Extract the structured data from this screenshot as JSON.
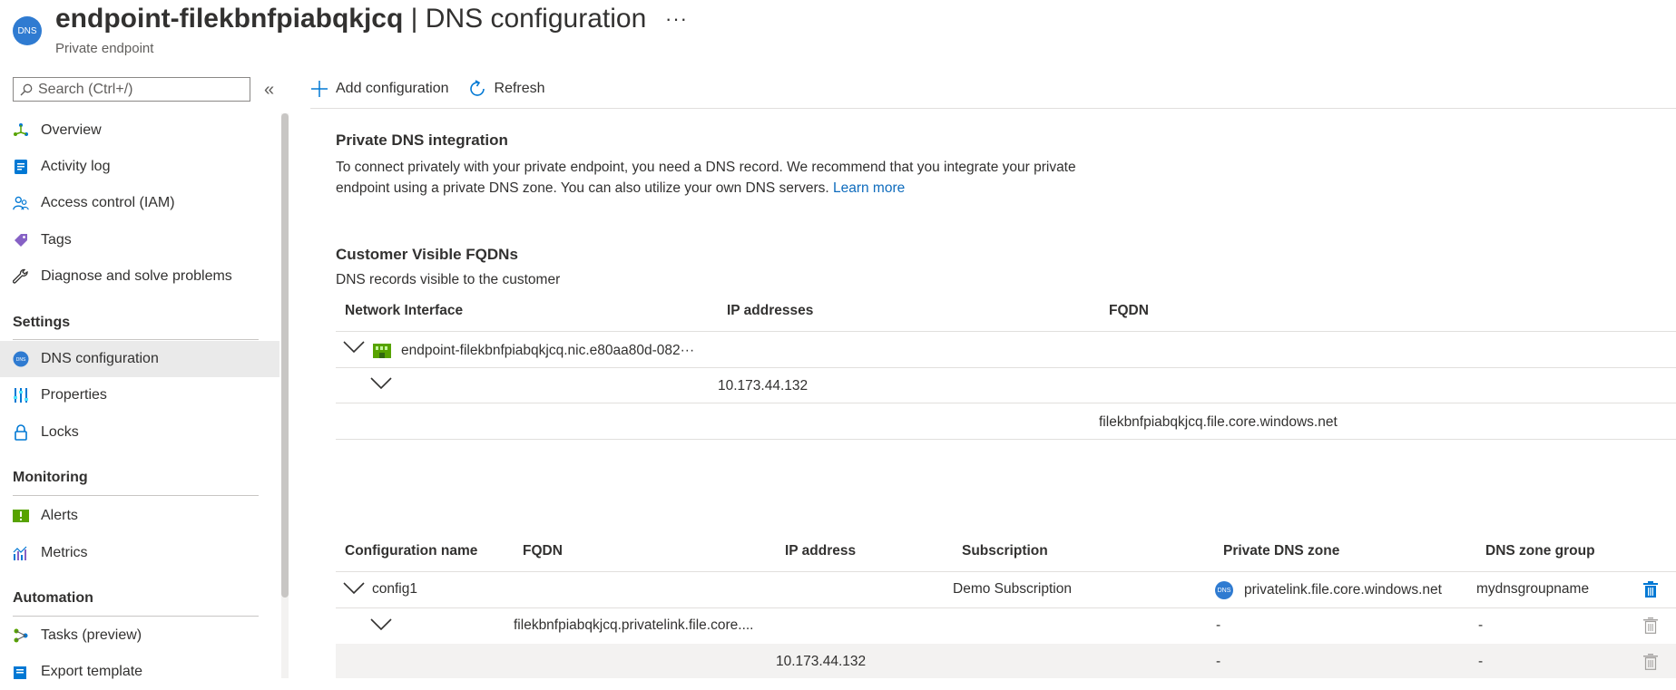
{
  "header": {
    "icon_text": "DNS",
    "resource_name": "endpoint-filekbnfpiabqkjcq",
    "separator": " | ",
    "page_name": "DNS configuration",
    "more": "···",
    "subtitle": "Private endpoint"
  },
  "search": {
    "placeholder": "Search (Ctrl+/)"
  },
  "collapse_glyph": "«",
  "sidebar": {
    "items": [
      {
        "label": "Overview",
        "icon": "overview-icon"
      },
      {
        "label": "Activity log",
        "icon": "activity-log-icon"
      },
      {
        "label": "Access control (IAM)",
        "icon": "people-icon"
      },
      {
        "label": "Tags",
        "icon": "tag-icon"
      },
      {
        "label": "Diagnose and solve problems",
        "icon": "wrench-icon"
      }
    ],
    "settings_header": "Settings",
    "settings_items": [
      {
        "label": "DNS configuration",
        "icon": "dns-icon",
        "active": true
      },
      {
        "label": "Properties",
        "icon": "properties-icon"
      },
      {
        "label": "Locks",
        "icon": "lock-icon"
      }
    ],
    "monitoring_header": "Monitoring",
    "monitoring_items": [
      {
        "label": "Alerts",
        "icon": "alert-icon"
      },
      {
        "label": "Metrics",
        "icon": "metrics-icon"
      }
    ],
    "automation_header": "Automation",
    "automation_items": [
      {
        "label": "Tasks (preview)",
        "icon": "tasks-icon"
      },
      {
        "label": "Export template",
        "icon": "export-icon"
      }
    ]
  },
  "toolbar": {
    "add_label": "Add configuration",
    "refresh_label": "Refresh"
  },
  "integration": {
    "title": "Private DNS integration",
    "text": "To connect privately with your private endpoint, you need a DNS record. We recommend that you integrate your private endpoint using a private DNS zone. You can also utilize your own DNS servers.",
    "learn_more": "Learn more"
  },
  "fqdns": {
    "title": "Customer Visible FQDNs",
    "subtitle": "DNS records visible to the customer",
    "columns": [
      "Network Interface",
      "IP addresses",
      "FQDN"
    ],
    "nic_link": "endpoint-filekbnfpiabqkjcq.nic.e80aa80d-082···",
    "ip": "10.173.44.132",
    "fqdn": "filekbnfpiabqkjcq.file.core.windows.net"
  },
  "configs": {
    "columns": [
      "Configuration name",
      "FQDN",
      "IP address",
      "Subscription",
      "Private DNS zone",
      "DNS zone group"
    ],
    "row1": {
      "name": "config1",
      "subscription": "Demo Subscription",
      "zone_icon": "DNS",
      "zone": "privatelink.file.core.windows.net",
      "group": "mydnsgroupname"
    },
    "row2": {
      "fqdn": "filekbnfpiabqkjcq.privatelink.file.core....",
      "zone": "-",
      "group": "-"
    },
    "row3": {
      "ip": "10.173.44.132",
      "zone": "-",
      "group": "-"
    }
  },
  "colors": {
    "link": "#0f6cbd",
    "azure_blue": "#2f7bd1",
    "active_bg": "#eaeaea"
  }
}
